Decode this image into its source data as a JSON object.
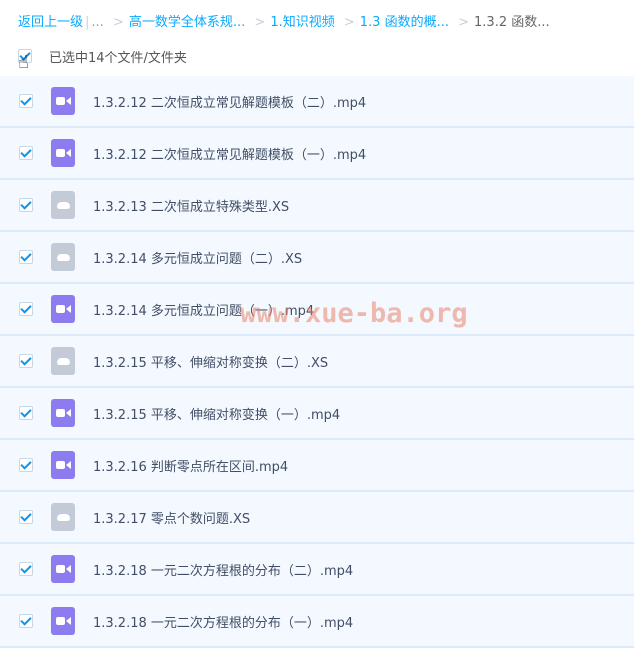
{
  "breadcrumb": {
    "back": "返回上一级",
    "ellipsis": "...",
    "items": [
      "高一数学全体系规...",
      "1.知识视频",
      "1.3 函数的概..."
    ],
    "current": "1.3.2 函数..."
  },
  "selection": {
    "text": "已选中14个文件/文件夹",
    "checked": true
  },
  "files": [
    {
      "name": "1.3.2.12 二次恒成立常见解题模板（二）.mp4",
      "type": "video",
      "checked": true
    },
    {
      "name": "1.3.2.12 二次恒成立常见解题模板（一）.mp4",
      "type": "video",
      "checked": true
    },
    {
      "name": "1.3.2.13 二次恒成立特殊类型.XS",
      "type": "cloud",
      "checked": true
    },
    {
      "name": "1.3.2.14 多元恒成立问题（二）.XS",
      "type": "cloud",
      "checked": true
    },
    {
      "name": "1.3.2.14 多元恒成立问题（一）.mp4",
      "type": "video",
      "checked": true
    },
    {
      "name": "1.3.2.15 平移、伸缩对称变换（二）.XS",
      "type": "cloud",
      "checked": true
    },
    {
      "name": "1.3.2.15 平移、伸缩对称变换（一）.mp4",
      "type": "video",
      "checked": true
    },
    {
      "name": "1.3.2.16 判断零点所在区间.mp4",
      "type": "video",
      "checked": true
    },
    {
      "name": "1.3.2.17 零点个数问题.XS",
      "type": "cloud",
      "checked": true
    },
    {
      "name": "1.3.2.18 一元二次方程根的分布（二）.mp4",
      "type": "video",
      "checked": true
    },
    {
      "name": "1.3.2.18 一元二次方程根的分布（一）.mp4",
      "type": "video",
      "checked": true
    }
  ],
  "watermark": "www.xue-ba.org",
  "colors": {
    "link": "#09aaff",
    "video_icon": "#8c7cf0",
    "cloud_icon": "#c3ccd6",
    "row_bg": "#f3f9fe"
  }
}
